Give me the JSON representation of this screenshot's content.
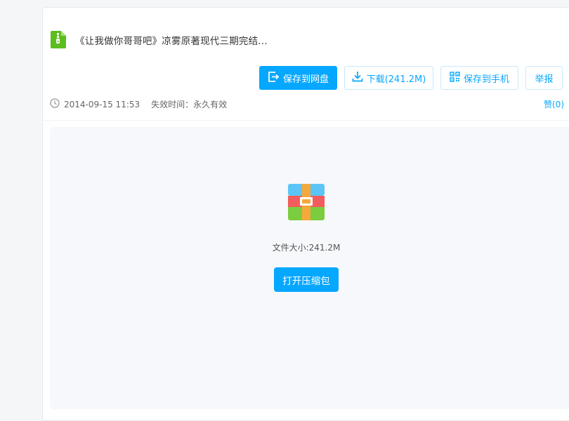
{
  "file": {
    "title": "《让我做你哥哥吧》凉雾原著现代三期完结...",
    "icon": "zip-file-icon",
    "date": "2014-09-15 11:53",
    "expire": "失效时间：永久有效"
  },
  "toolbar": {
    "save_label": "保存到网盘",
    "download_label": "下载(241.2M)",
    "phone_label": "保存到手机",
    "report_label": "举报"
  },
  "likes": {
    "label": "赞(0)"
  },
  "preview": {
    "size_label": "文件大小:241.2M",
    "open_label": "打开压缩包"
  },
  "colors": {
    "accent": "#06a7ff",
    "file_icon_green": "#52c41a"
  }
}
